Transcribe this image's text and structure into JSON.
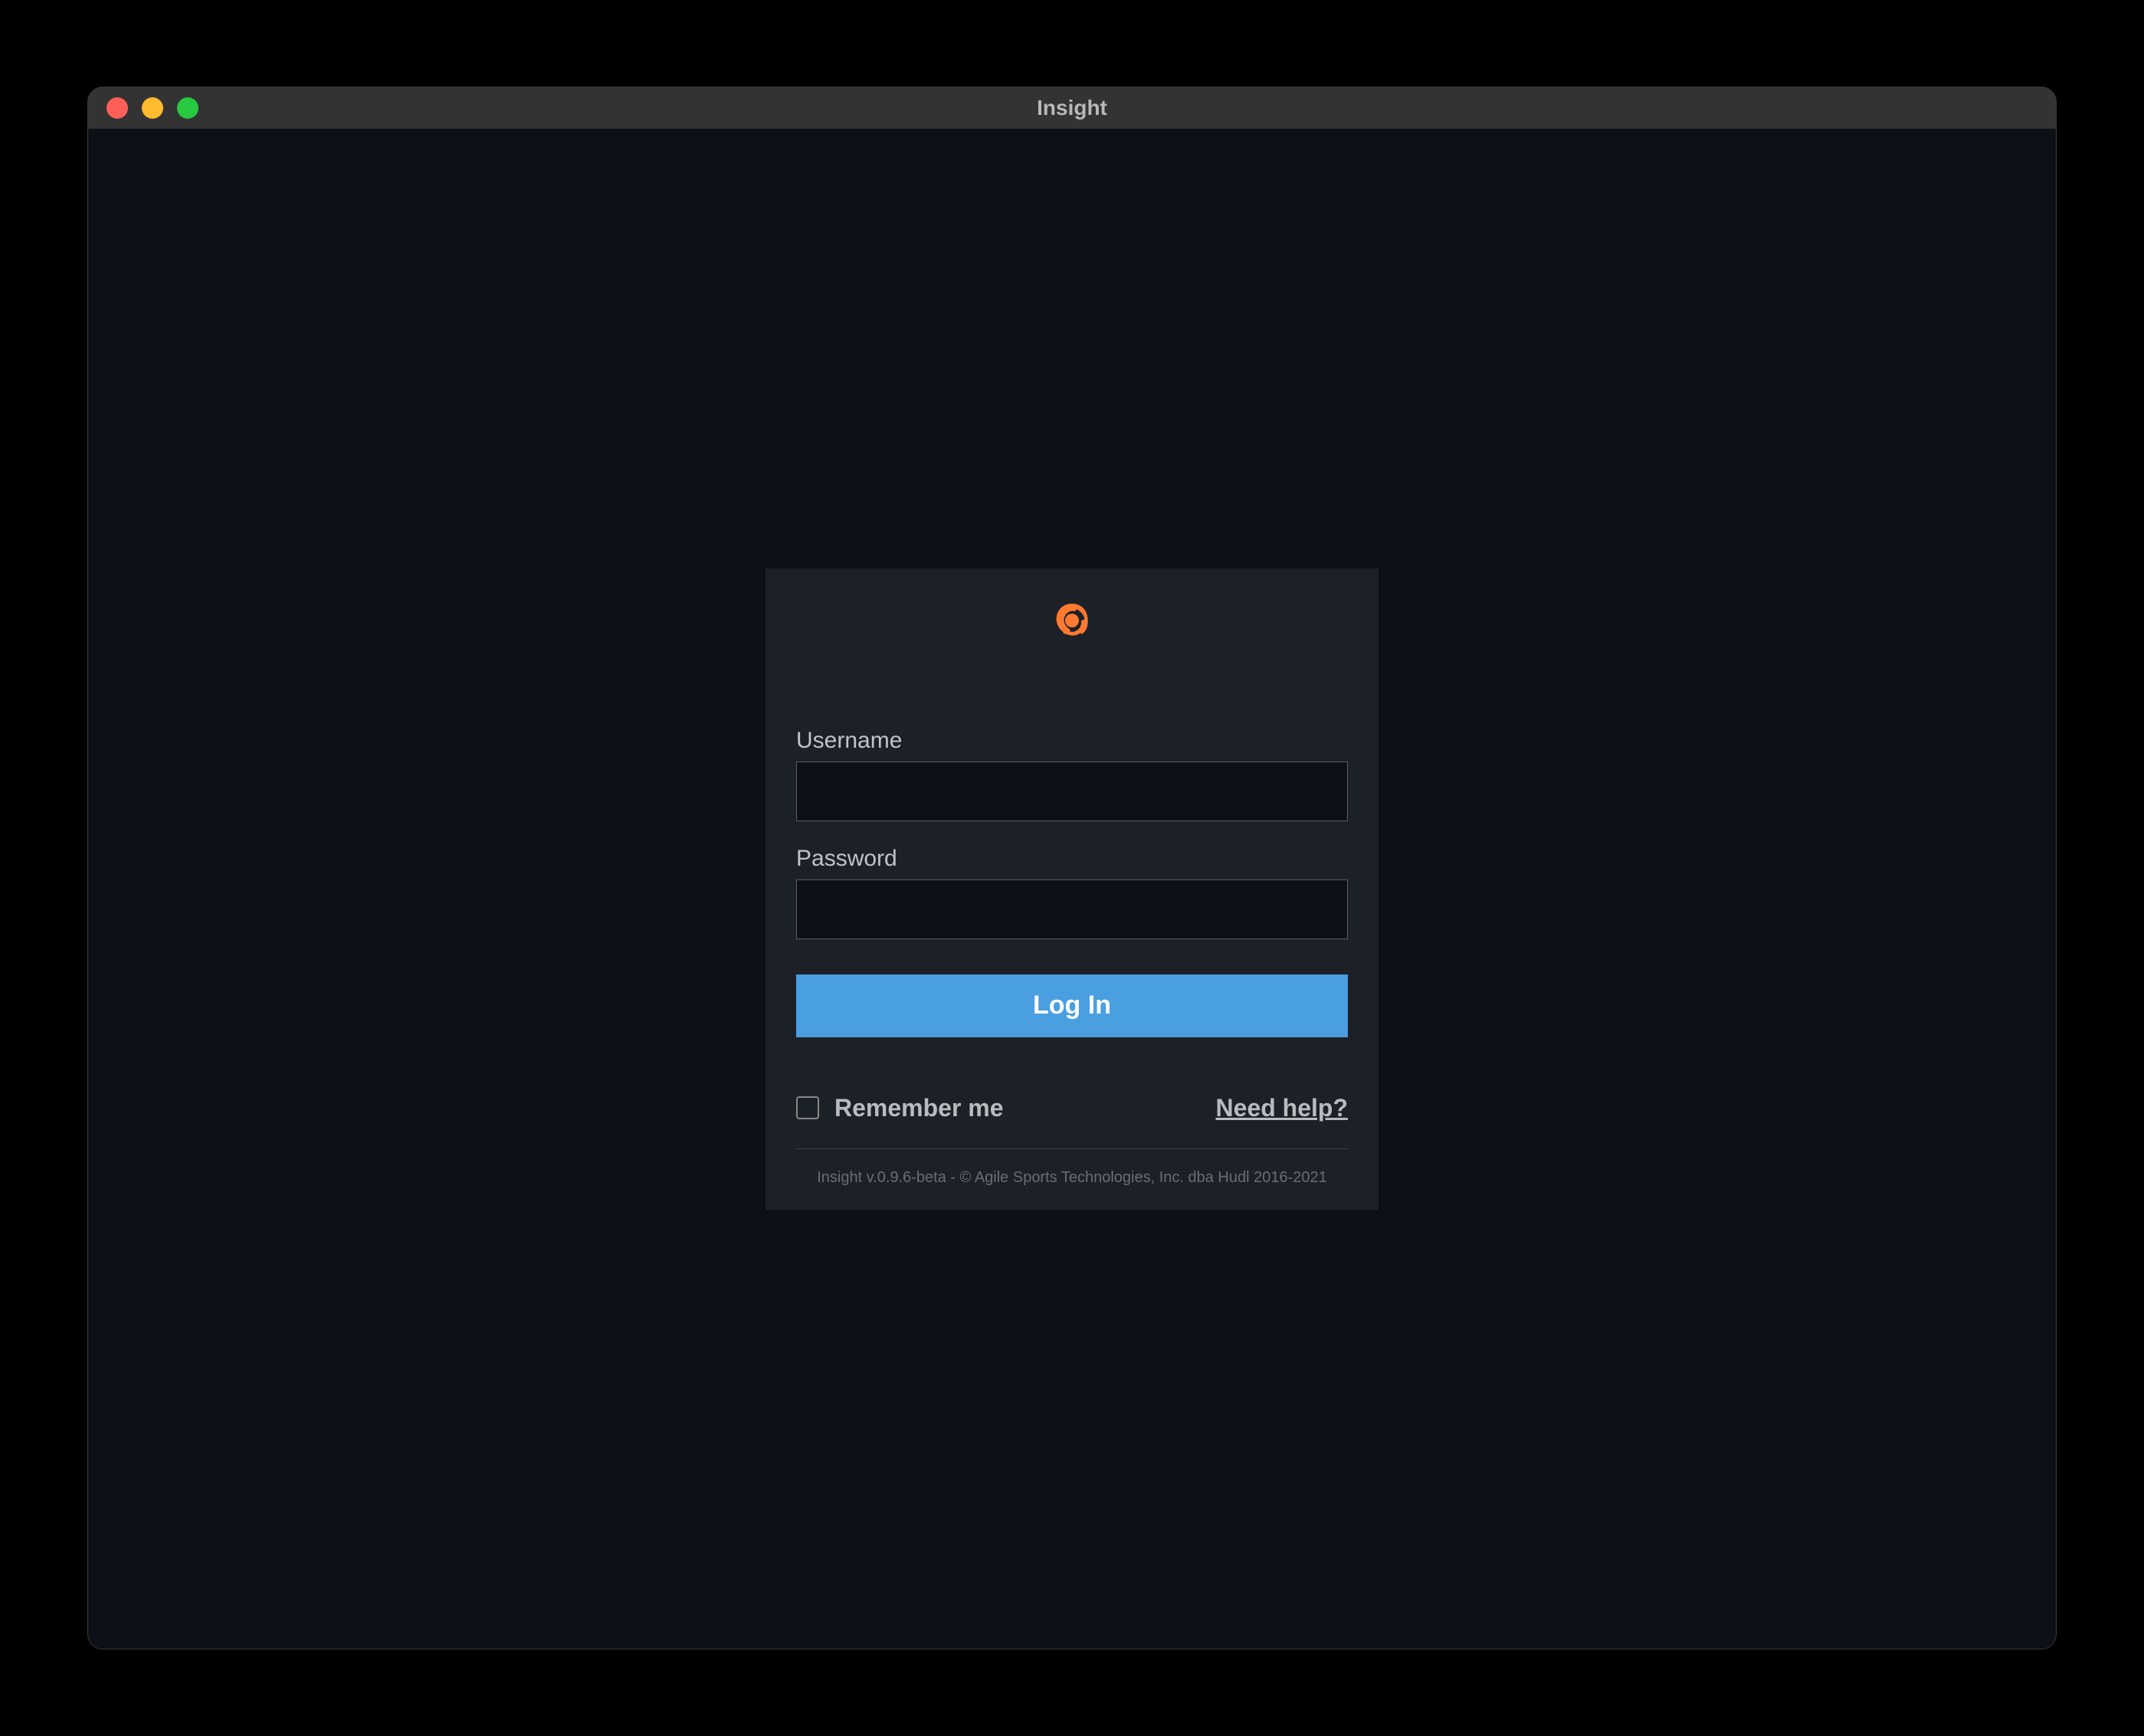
{
  "window": {
    "title": "Insight"
  },
  "login": {
    "username_label": "Username",
    "username_value": "",
    "password_label": "Password",
    "password_value": "",
    "button_label": "Log In",
    "remember_label": "Remember me",
    "help_label": "Need help?",
    "footer": "Insight v.0.9.6-beta - © Agile Sports Technologies, Inc. dba Hudl 2016-2021"
  },
  "colors": {
    "accent": "#ff7a30",
    "button": "#4a9fe0"
  }
}
